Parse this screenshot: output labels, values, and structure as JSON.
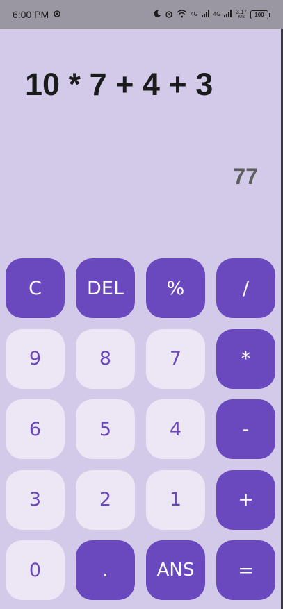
{
  "status_bar": {
    "time": "6:00 PM",
    "network_1": "4G",
    "network_2": "4G",
    "speed": "3.17",
    "speed_unit": "K/S",
    "battery": "100"
  },
  "display": {
    "expression": "10 * 7 + 4 + 3",
    "result": "77"
  },
  "keypad": {
    "keys": [
      {
        "label": "C",
        "style": "op"
      },
      {
        "label": "DEL",
        "style": "op"
      },
      {
        "label": "%",
        "style": "op"
      },
      {
        "label": "/",
        "style": "op"
      },
      {
        "label": "9",
        "style": "num"
      },
      {
        "label": "8",
        "style": "num"
      },
      {
        "label": "7",
        "style": "num"
      },
      {
        "label": "*",
        "style": "op"
      },
      {
        "label": "6",
        "style": "num"
      },
      {
        "label": "5",
        "style": "num"
      },
      {
        "label": "4",
        "style": "num"
      },
      {
        "label": "-",
        "style": "op"
      },
      {
        "label": "3",
        "style": "num"
      },
      {
        "label": "2",
        "style": "num"
      },
      {
        "label": "1",
        "style": "num"
      },
      {
        "label": "+",
        "style": "op"
      },
      {
        "label": "0",
        "style": "num"
      },
      {
        "label": ".",
        "style": "op"
      },
      {
        "label": "ANS",
        "style": "op"
      },
      {
        "label": "=",
        "style": "op"
      }
    ]
  },
  "colors": {
    "background": "#d2cae8",
    "operator_key": "#6a48be",
    "number_key": "#ede7f5",
    "number_text": "#6848b8"
  }
}
